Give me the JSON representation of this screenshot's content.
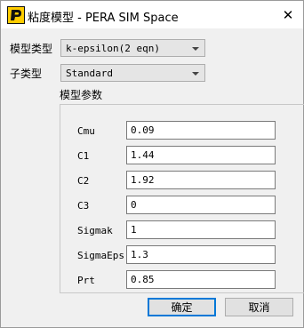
{
  "window": {
    "title": "粘度模型 - PERA SIM Space",
    "icon": "pera-logo-icon",
    "close_label": "✕"
  },
  "form": {
    "model_type_label": "模型类型",
    "model_type_value": "k-epsilon(2 eqn)",
    "sub_type_label": "子类型",
    "sub_type_value": "Standard",
    "params_group_label": "模型参数"
  },
  "params": [
    {
      "name": "Cmu",
      "value": "0.09"
    },
    {
      "name": "C1",
      "value": "1.44"
    },
    {
      "name": "C2",
      "value": "1.92"
    },
    {
      "name": "C3",
      "value": "0"
    },
    {
      "name": "Sigmak",
      "value": "1"
    },
    {
      "name": "SigmaEps",
      "value": "1.3"
    },
    {
      "name": "Prt",
      "value": "0.85"
    }
  ],
  "buttons": {
    "ok_label": "确定",
    "cancel_label": "取消"
  },
  "colors": {
    "window_bg": "#f0f0f0",
    "title_bg": "#ffffff",
    "icon_yellow": "#ffcc00",
    "focus_blue": "#0078d7"
  }
}
